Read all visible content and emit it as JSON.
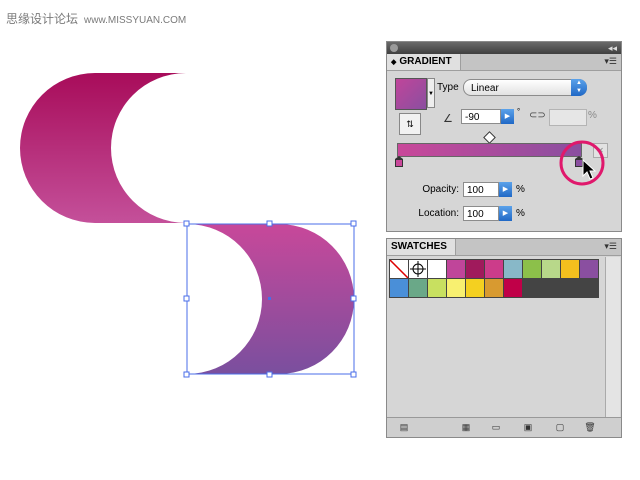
{
  "watermark": {
    "text": "思缘设计论坛",
    "url": "www.MISSYUAN.COM"
  },
  "gradient_panel": {
    "tab": "GRADIENT",
    "type_label": "Type",
    "type_value": "Linear",
    "angle": "-90",
    "degree_symbol": "°",
    "aspect_percent": "%",
    "opacity_label": "Opacity:",
    "opacity_value": "100",
    "location_label": "Location:",
    "location_value": "100",
    "percent": "%",
    "gradient_start_color": "#c9489a",
    "gradient_end_color": "#8a4fa0"
  },
  "swatches_panel": {
    "tab": "SWATCHES",
    "swatches": [
      "none",
      "registration",
      "#ffffff",
      "#c0459a",
      "#a01a5c",
      "#cc3c8a",
      "#88b8c8",
      "#8cc04a",
      "#b8d88a",
      "#f4c01e",
      "#8a4fa0",
      "#4a8fd8",
      "#6aa888",
      "#c8e060",
      "#f8f070",
      "#f4d020",
      "#d89a30",
      "#c00048"
    ]
  },
  "icons": [
    "close-icon",
    "collapse-icon",
    "panel-menu-icon",
    "reverse-gradient-icon",
    "angle-icon",
    "aspect-ratio-icon",
    "delete-stop-icon",
    "gradient-stop-icon",
    "cursor-icon",
    "swatch-library-icon",
    "new-swatch-icon",
    "delete-swatch-icon"
  ],
  "colors": {
    "highlight_ring": "#e0186c",
    "selection": "#4a6ee8"
  }
}
